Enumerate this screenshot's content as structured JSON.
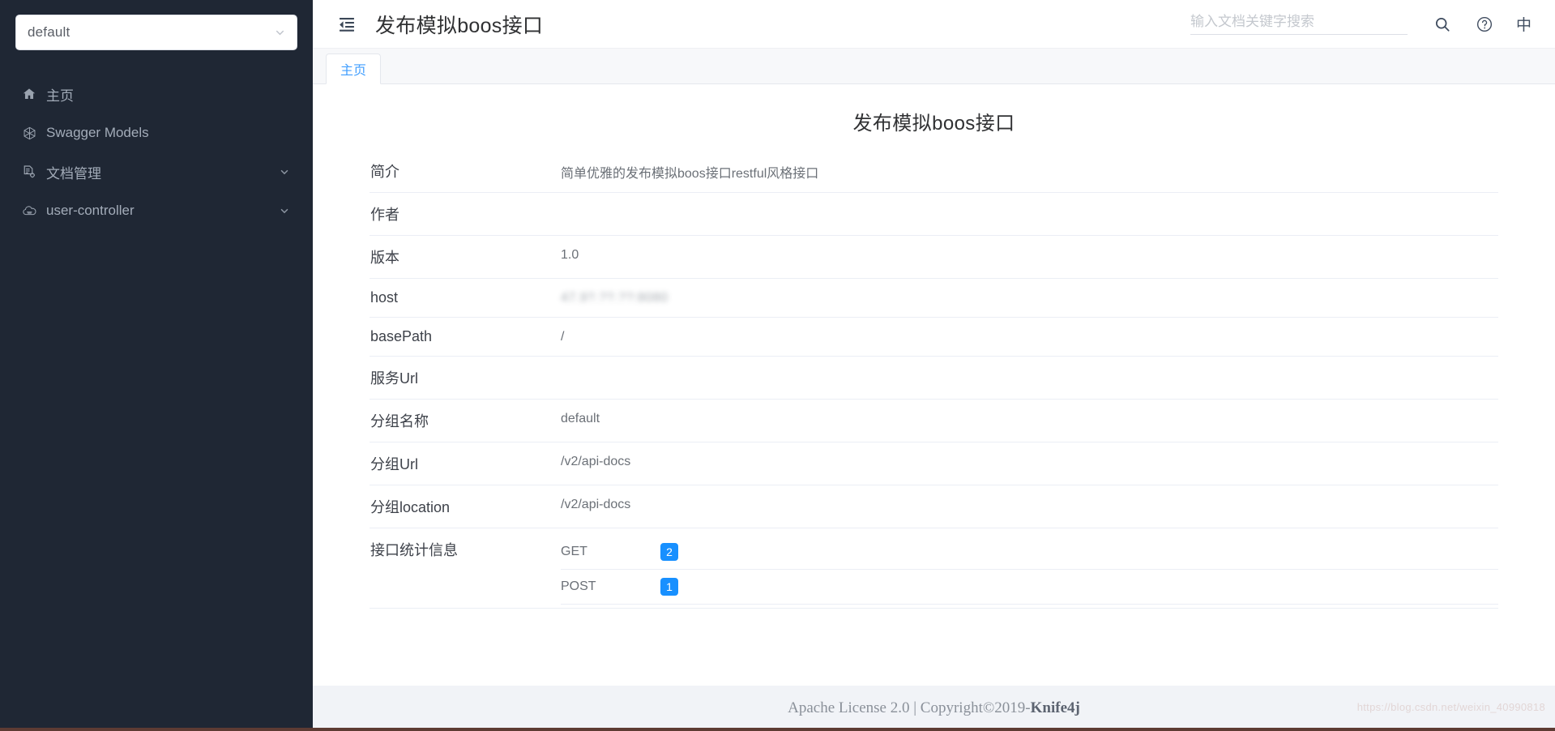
{
  "sidebar": {
    "group_select": {
      "value": "default",
      "icon": "chevron-down-icon"
    },
    "items": [
      {
        "label": "主页",
        "icon": "home-icon",
        "has_arrow": false
      },
      {
        "label": "Swagger Models",
        "icon": "cube-icon",
        "has_arrow": false
      },
      {
        "label": "文档管理",
        "icon": "document-settings-icon",
        "has_arrow": true
      },
      {
        "label": "user-controller",
        "icon": "cloud-icon",
        "has_arrow": true
      }
    ]
  },
  "topbar": {
    "fold_icon": "menu-fold-icon",
    "title": "发布模拟boos接口",
    "search": {
      "placeholder": "输入文档关键字搜索",
      "value": ""
    },
    "search_icon": "search-icon",
    "help_icon": "question-circle-icon",
    "language_label": "中"
  },
  "tabs": [
    {
      "label": "主页",
      "active": true
    }
  ],
  "content": {
    "doc_title": "发布模拟boos接口",
    "rows": [
      {
        "key": "简介",
        "value": "简单优雅的发布模拟boos接口restful风格接口",
        "blurred": false
      },
      {
        "key": "作者",
        "value": "",
        "blurred": false
      },
      {
        "key": "版本",
        "value": "1.0",
        "blurred": false
      },
      {
        "key": "host",
        "value": "47.9?.??.??:8080",
        "blurred": true
      },
      {
        "key": "basePath",
        "value": "/",
        "blurred": false
      },
      {
        "key": "服务Url",
        "value": "",
        "blurred": false
      },
      {
        "key": "分组名称",
        "value": "default",
        "blurred": false
      },
      {
        "key": "分组Url",
        "value": "/v2/api-docs",
        "blurred": false
      },
      {
        "key": "分组location",
        "value": "/v2/api-docs",
        "blurred": false
      }
    ],
    "stats": {
      "key": "接口统计信息",
      "entries": [
        {
          "method": "GET",
          "count": "2"
        },
        {
          "method": "POST",
          "count": "1"
        }
      ]
    }
  },
  "footer": {
    "license": "Apache License 2.0 | Copyright ",
    "copyright_symbol": "©",
    "year_brand": " 2019-",
    "brand": "Knife4j",
    "watermark": "https://blog.csdn.net/weixin_40990818"
  },
  "colors": {
    "sidebar_bg": "#1f2734",
    "accent_blue": "#409eff",
    "badge_blue": "#1890ff",
    "footer_bg": "#f1f3f7"
  }
}
